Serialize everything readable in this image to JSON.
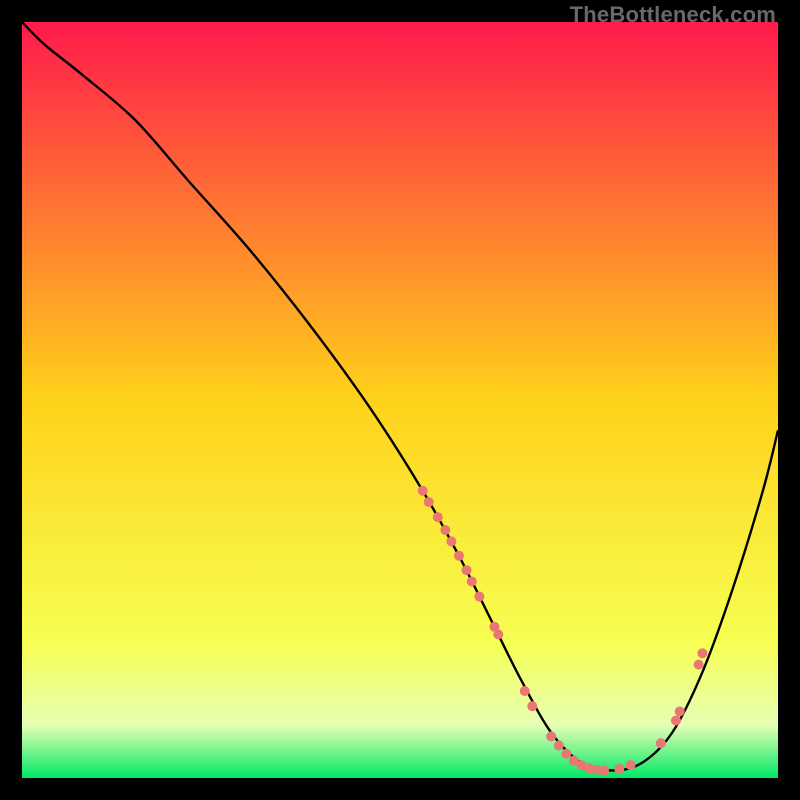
{
  "watermark": "TheBottleneck.com",
  "chart_data": {
    "type": "line",
    "title": "",
    "xlabel": "",
    "ylabel": "",
    "xlim": [
      0,
      100
    ],
    "ylim": [
      0,
      100
    ],
    "grid": false,
    "legend": false,
    "background_gradient": {
      "stops": [
        {
          "pos": 0.0,
          "color": "#ff1a4b"
        },
        {
          "pos": 0.5,
          "color": "#ffd21a"
        },
        {
          "pos": 0.82,
          "color": "#f6ff52"
        },
        {
          "pos": 0.93,
          "color": "#e6ffb4"
        },
        {
          "pos": 1.0,
          "color": "#00e865"
        }
      ]
    },
    "series": [
      {
        "name": "bottleneck-curve",
        "color": "#000000",
        "x": [
          0,
          3,
          8,
          15,
          22,
          30,
          38,
          46,
          53,
          58,
          62,
          66,
          70,
          74,
          78,
          82,
          86,
          90,
          94,
          98,
          100
        ],
        "y": [
          100,
          97,
          93,
          87,
          79,
          70,
          60,
          49,
          38,
          29,
          21,
          13,
          6,
          2,
          1,
          2,
          6,
          14,
          25,
          38,
          46
        ]
      }
    ],
    "scatter": {
      "name": "highlight-points",
      "color": "#e97772",
      "radius": 5,
      "points": [
        {
          "x": 53.0,
          "y": 38.0
        },
        {
          "x": 53.8,
          "y": 36.5
        },
        {
          "x": 55.0,
          "y": 34.5
        },
        {
          "x": 56.0,
          "y": 32.8
        },
        {
          "x": 56.8,
          "y": 31.3
        },
        {
          "x": 57.8,
          "y": 29.4
        },
        {
          "x": 58.8,
          "y": 27.5
        },
        {
          "x": 59.5,
          "y": 26.0
        },
        {
          "x": 60.5,
          "y": 24.0
        },
        {
          "x": 62.5,
          "y": 20.0
        },
        {
          "x": 63.0,
          "y": 19.0
        },
        {
          "x": 66.5,
          "y": 11.5
        },
        {
          "x": 67.5,
          "y": 9.5
        },
        {
          "x": 70.0,
          "y": 5.5
        },
        {
          "x": 71.0,
          "y": 4.3
        },
        {
          "x": 72.0,
          "y": 3.2
        },
        {
          "x": 73.0,
          "y": 2.3
        },
        {
          "x": 74.0,
          "y": 1.7
        },
        {
          "x": 75.0,
          "y": 1.3
        },
        {
          "x": 76.0,
          "y": 1.1
        },
        {
          "x": 77.0,
          "y": 1.0
        },
        {
          "x": 79.0,
          "y": 1.2
        },
        {
          "x": 80.5,
          "y": 1.7
        },
        {
          "x": 84.5,
          "y": 4.6
        },
        {
          "x": 86.5,
          "y": 7.6
        },
        {
          "x": 87.0,
          "y": 8.8
        },
        {
          "x": 89.5,
          "y": 15.0
        },
        {
          "x": 90.0,
          "y": 16.5
        }
      ]
    }
  }
}
